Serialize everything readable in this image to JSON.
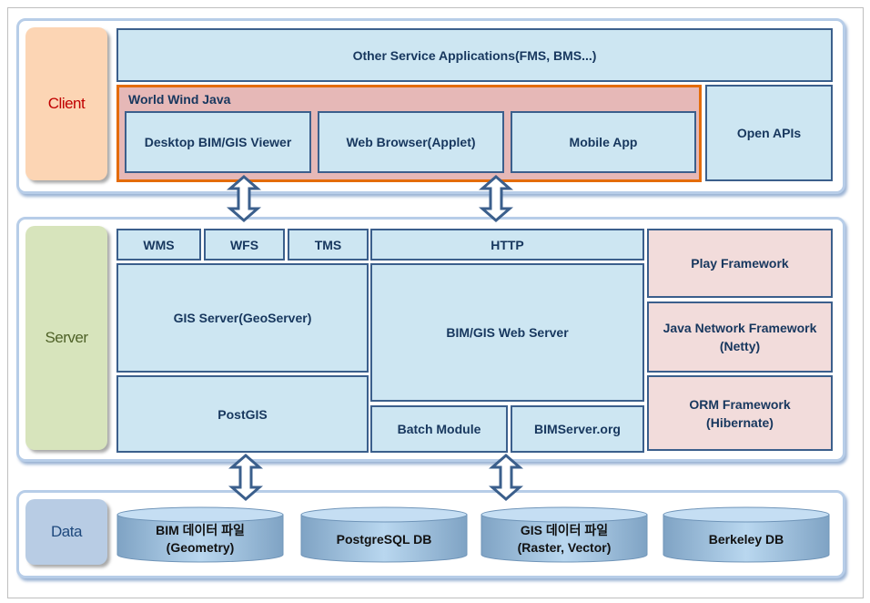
{
  "client": {
    "label": "Client",
    "other": "Other Service Applications(FMS,  BMS...)",
    "wwj": "World Wind Java",
    "desktop": "Desktop  BIM/GIS Viewer",
    "web": "Web Browser(Applet)",
    "mobile": "Mobile App",
    "openapis": "Open APIs"
  },
  "server": {
    "label": "Server",
    "wms": "WMS",
    "wfs": "WFS",
    "tms": "TMS",
    "http": "HTTP",
    "gis": "GIS Server(GeoServer)",
    "postgis": "PostGIS",
    "web": "BIM/GIS Web Server",
    "batch": "Batch Module",
    "bimserver": "BIMServer.org",
    "play": "Play Framework",
    "netty1": "Java Network  Framework",
    "netty2": "(Netty)",
    "orm1": "ORM Framework",
    "orm2": "(Hibernate)"
  },
  "data": {
    "label": "Data",
    "db": [
      {
        "l1": "BIM 데이터 파일",
        "l2": "(Geometry)"
      },
      {
        "l1": "PostgreSQL  DB",
        "l2": ""
      },
      {
        "l1": "GIS 데이터 파일",
        "l2": "(Raster, Vector)"
      },
      {
        "l1": "Berkeley DB",
        "l2": ""
      }
    ]
  },
  "colors": {
    "client": "#fcd5b4",
    "server": "#d7e4bc",
    "data": "#b8cce4",
    "box": "#cde6f2",
    "wwj": "#e6b8b7",
    "wwj_border": "#e46c0a"
  }
}
